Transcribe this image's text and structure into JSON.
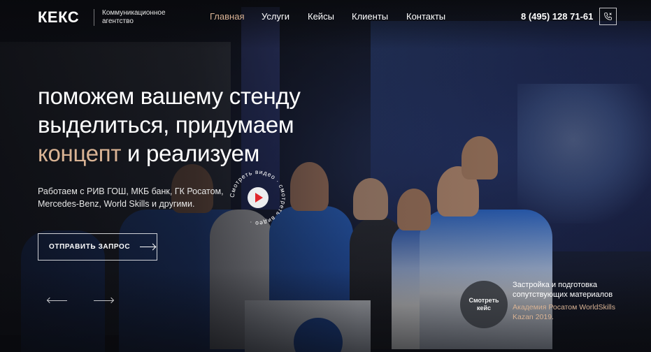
{
  "brand": {
    "logo": "КЕКС",
    "tagline_line1": "Коммуникационное",
    "tagline_line2": "агентство"
  },
  "nav": {
    "items": [
      {
        "label": "Главная",
        "active": true
      },
      {
        "label": "Услуги"
      },
      {
        "label": "Кейсы"
      },
      {
        "label": "Клиенты"
      },
      {
        "label": "Контакты"
      }
    ]
  },
  "contact": {
    "phone": "8 (495) 128 71-61",
    "phone_icon": "phone-icon"
  },
  "hero": {
    "headline_line1": "поможем вашему стенду",
    "headline_line2": "выделиться, придумаем",
    "headline_accent": "концепт",
    "headline_rest": " и реализуем",
    "subtitle": "Работаем с РИВ ГОШ, МКБ банк, ГК Росатом, Mercedes-Benz, World Skills и другими.",
    "cta_label": "ОТПРАВИТЬ ЗАПРОС",
    "video_ring_text": "Смотреть видео · смотреть видео · "
  },
  "case": {
    "button_line1": "Смотреть",
    "button_line2": "кейс",
    "title": "Застройка и подготовка сопутствующих материалов",
    "subtitle": "Академия Росатом WorldSkills Kazan 2019."
  },
  "colors": {
    "accent": "#d9b394",
    "play": "#e0262c"
  }
}
